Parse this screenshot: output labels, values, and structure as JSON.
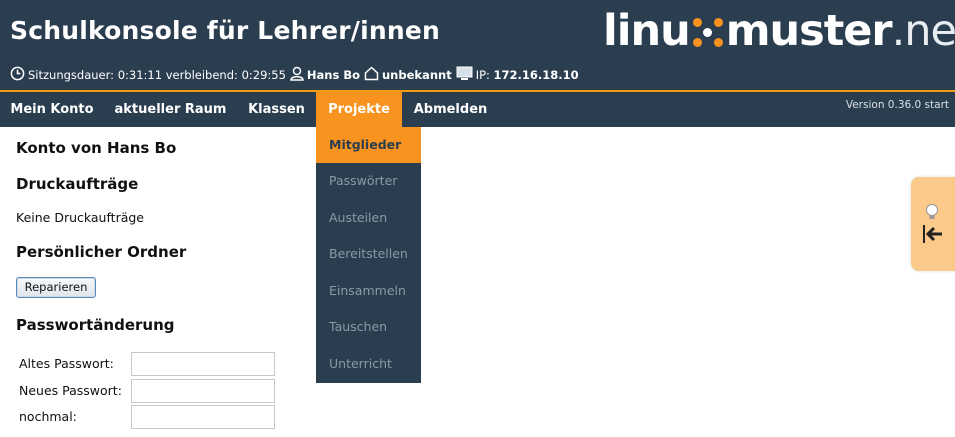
{
  "header": {
    "title": "Schulkonsole für Lehrer/innen",
    "logo": {
      "part1": "linu",
      "part2": "muster",
      "part3": ".net",
      "icon": "linuxmuster-x-logo"
    }
  },
  "session": {
    "duration_label": "Sitzungsdauer:",
    "duration_value": "0:31:11",
    "remaining_label": "verbleibend:",
    "remaining_value": "0:29:55",
    "user": "Hans Bo",
    "room": "unbekannt",
    "ip_label": "IP:",
    "ip_value": "172.16.18.10"
  },
  "nav": {
    "items": [
      {
        "label": "Mein Konto"
      },
      {
        "label": "aktueller Raum"
      },
      {
        "label": "Klassen"
      },
      {
        "label": "Projekte"
      },
      {
        "label": "Abmelden"
      }
    ],
    "active": "Projekte",
    "version": "Version 0.36.0 start"
  },
  "dropdown": {
    "items": [
      {
        "label": "Mitglieder"
      },
      {
        "label": "Passwörter"
      },
      {
        "label": "Austeilen"
      },
      {
        "label": "Bereitstellen"
      },
      {
        "label": "Einsammeln"
      },
      {
        "label": "Tauschen"
      },
      {
        "label": "Unterricht"
      }
    ],
    "active": "Mitglieder"
  },
  "main": {
    "account_heading": "Konto von Hans Bo",
    "print_heading": "Druckaufträge",
    "print_text": "Keine Druckaufträge",
    "folder_heading": "Persönlicher Ordner",
    "repair_button": "Reparieren",
    "password_heading": "Passwortänderung",
    "fields": [
      {
        "label": "Altes Passwort:",
        "value": ""
      },
      {
        "label": "Neues Passwort:",
        "value": ""
      },
      {
        "label": "nochmal:",
        "value": ""
      }
    ]
  },
  "colors": {
    "header_bg": "#2b3e50",
    "accent": "#f7931e",
    "side_tab": "#fbc98a"
  },
  "icons": {
    "clock": "clock-icon",
    "user": "user-icon",
    "room": "house-icon",
    "computer": "monitor-icon",
    "hint": "lightbulb-icon",
    "collapse": "arrow-left-bar-icon"
  }
}
